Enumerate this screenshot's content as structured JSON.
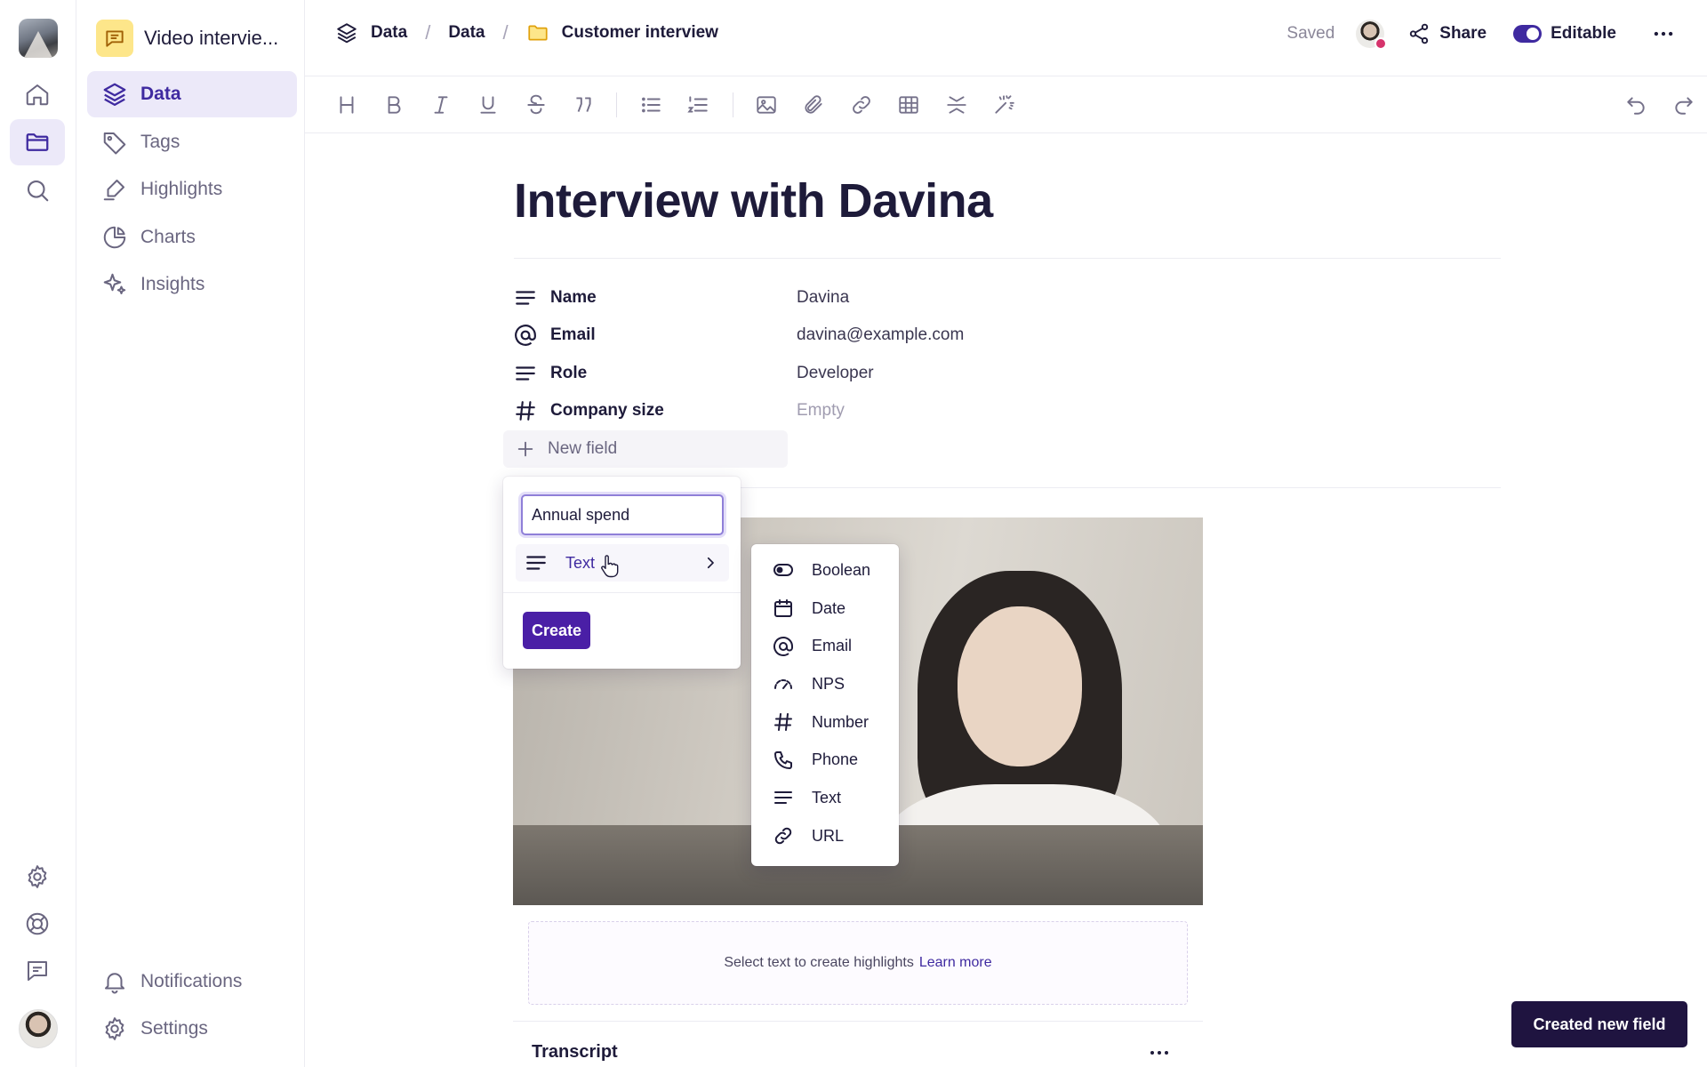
{
  "project": {
    "name": "Video intervie..."
  },
  "sidebar": {
    "items": [
      {
        "label": "Data",
        "icon": "layers-icon"
      },
      {
        "label": "Tags",
        "icon": "tag-icon"
      },
      {
        "label": "Highlights",
        "icon": "highlighter-icon"
      },
      {
        "label": "Charts",
        "icon": "pie-chart-icon"
      },
      {
        "label": "Insights",
        "icon": "sparkle-icon"
      }
    ],
    "bottom": [
      {
        "label": "Notifications",
        "icon": "bell-icon"
      },
      {
        "label": "Settings",
        "icon": "gear-icon"
      }
    ]
  },
  "breadcrumb": [
    "Data",
    "Data",
    "Customer interview"
  ],
  "topbar": {
    "saved": "Saved",
    "share": "Share",
    "editable": "Editable"
  },
  "document": {
    "title": "Interview with Davina",
    "properties": [
      {
        "label": "Name",
        "value": "Davina",
        "icon": "text-lines-icon"
      },
      {
        "label": "Email",
        "value": "davina@example.com",
        "icon": "at-icon"
      },
      {
        "label": "Role",
        "value": "Developer",
        "icon": "text-lines-icon"
      },
      {
        "label": "Company size",
        "value": "Empty",
        "icon": "hash-icon"
      }
    ],
    "new_field": "New field",
    "highlight_hint": "Select text to create highlights",
    "learn_more": "Learn more",
    "transcript": "Transcript"
  },
  "new_field_popover": {
    "input_value": "Annual spend",
    "type_label": "Text",
    "create_label": "Create"
  },
  "type_menu": [
    {
      "label": "Boolean",
      "icon": "toggle-icon"
    },
    {
      "label": "Date",
      "icon": "calendar-icon"
    },
    {
      "label": "Email",
      "icon": "at-icon"
    },
    {
      "label": "NPS",
      "icon": "gauge-icon"
    },
    {
      "label": "Number",
      "icon": "hash-icon"
    },
    {
      "label": "Phone",
      "icon": "phone-icon"
    },
    {
      "label": "Text",
      "icon": "text-lines-icon"
    },
    {
      "label": "URL",
      "icon": "link-icon"
    }
  ],
  "toast": "Created new field",
  "colors": {
    "accent": "#3f2aa0",
    "button": "#4a1fa6",
    "toast_bg": "#1f1440",
    "active_bg": "#ece9f9"
  }
}
